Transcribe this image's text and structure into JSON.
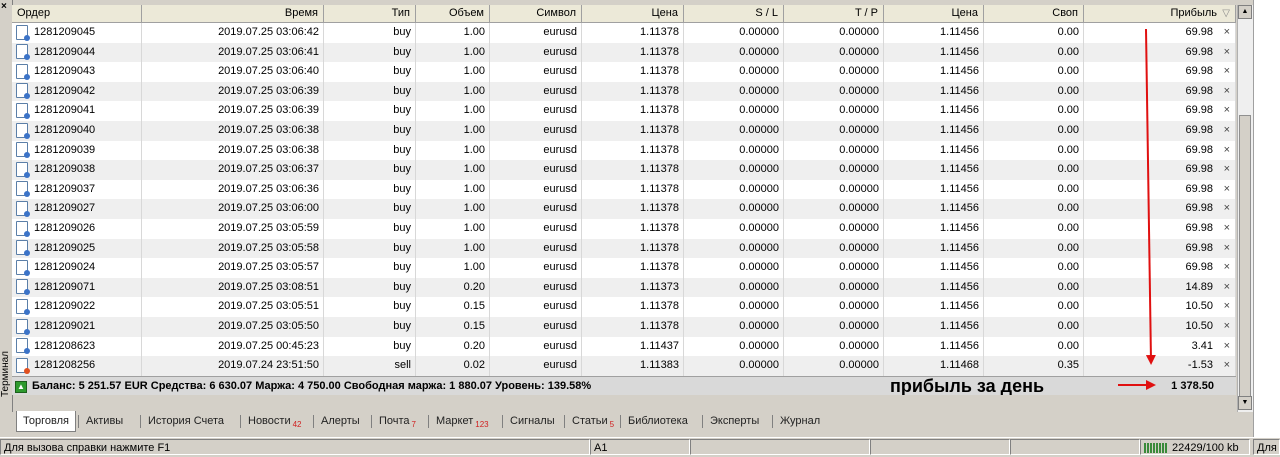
{
  "terminal_label": "Терминал",
  "close_symbol": "×",
  "columns": [
    {
      "label": "Ордер",
      "align": "left",
      "w": 130
    },
    {
      "label": "Время",
      "align": "right",
      "w": 182
    },
    {
      "label": "Тип",
      "align": "right",
      "w": 92
    },
    {
      "label": "Объем",
      "align": "right",
      "w": 74
    },
    {
      "label": "Символ",
      "align": "right",
      "w": 92
    },
    {
      "label": "Цена",
      "align": "right",
      "w": 102
    },
    {
      "label": "S / L",
      "align": "right",
      "w": 100
    },
    {
      "label": "T / P",
      "align": "right",
      "w": 100
    },
    {
      "label": "Цена",
      "align": "right",
      "w": 100
    },
    {
      "label": "Своп",
      "align": "right",
      "w": 100
    },
    {
      "label": "Прибыль",
      "align": "right",
      "w": 152
    }
  ],
  "sort_indicator": "▽",
  "rows": [
    [
      "1281209045",
      "2019.07.25 03:06:42",
      "buy",
      "1.00",
      "eurusd",
      "1.11378",
      "0.00000",
      "0.00000",
      "1.11456",
      "0.00",
      "69.98"
    ],
    [
      "1281209044",
      "2019.07.25 03:06:41",
      "buy",
      "1.00",
      "eurusd",
      "1.11378",
      "0.00000",
      "0.00000",
      "1.11456",
      "0.00",
      "69.98"
    ],
    [
      "1281209043",
      "2019.07.25 03:06:40",
      "buy",
      "1.00",
      "eurusd",
      "1.11378",
      "0.00000",
      "0.00000",
      "1.11456",
      "0.00",
      "69.98"
    ],
    [
      "1281209042",
      "2019.07.25 03:06:39",
      "buy",
      "1.00",
      "eurusd",
      "1.11378",
      "0.00000",
      "0.00000",
      "1.11456",
      "0.00",
      "69.98"
    ],
    [
      "1281209041",
      "2019.07.25 03:06:39",
      "buy",
      "1.00",
      "eurusd",
      "1.11378",
      "0.00000",
      "0.00000",
      "1.11456",
      "0.00",
      "69.98"
    ],
    [
      "1281209040",
      "2019.07.25 03:06:38",
      "buy",
      "1.00",
      "eurusd",
      "1.11378",
      "0.00000",
      "0.00000",
      "1.11456",
      "0.00",
      "69.98"
    ],
    [
      "1281209039",
      "2019.07.25 03:06:38",
      "buy",
      "1.00",
      "eurusd",
      "1.11378",
      "0.00000",
      "0.00000",
      "1.11456",
      "0.00",
      "69.98"
    ],
    [
      "1281209038",
      "2019.07.25 03:06:37",
      "buy",
      "1.00",
      "eurusd",
      "1.11378",
      "0.00000",
      "0.00000",
      "1.11456",
      "0.00",
      "69.98"
    ],
    [
      "1281209037",
      "2019.07.25 03:06:36",
      "buy",
      "1.00",
      "eurusd",
      "1.11378",
      "0.00000",
      "0.00000",
      "1.11456",
      "0.00",
      "69.98"
    ],
    [
      "1281209027",
      "2019.07.25 03:06:00",
      "buy",
      "1.00",
      "eurusd",
      "1.11378",
      "0.00000",
      "0.00000",
      "1.11456",
      "0.00",
      "69.98"
    ],
    [
      "1281209026",
      "2019.07.25 03:05:59",
      "buy",
      "1.00",
      "eurusd",
      "1.11378",
      "0.00000",
      "0.00000",
      "1.11456",
      "0.00",
      "69.98"
    ],
    [
      "1281209025",
      "2019.07.25 03:05:58",
      "buy",
      "1.00",
      "eurusd",
      "1.11378",
      "0.00000",
      "0.00000",
      "1.11456",
      "0.00",
      "69.98"
    ],
    [
      "1281209024",
      "2019.07.25 03:05:57",
      "buy",
      "1.00",
      "eurusd",
      "1.11378",
      "0.00000",
      "0.00000",
      "1.11456",
      "0.00",
      "69.98"
    ],
    [
      "1281209071",
      "2019.07.25 03:08:51",
      "buy",
      "0.20",
      "eurusd",
      "1.11373",
      "0.00000",
      "0.00000",
      "1.11456",
      "0.00",
      "14.89"
    ],
    [
      "1281209022",
      "2019.07.25 03:05:51",
      "buy",
      "0.15",
      "eurusd",
      "1.11378",
      "0.00000",
      "0.00000",
      "1.11456",
      "0.00",
      "10.50"
    ],
    [
      "1281209021",
      "2019.07.25 03:05:50",
      "buy",
      "0.15",
      "eurusd",
      "1.11378",
      "0.00000",
      "0.00000",
      "1.11456",
      "0.00",
      "10.50"
    ],
    [
      "1281208623",
      "2019.07.25 00:45:23",
      "buy",
      "0.20",
      "eurusd",
      "1.11437",
      "0.00000",
      "0.00000",
      "1.11456",
      "0.00",
      "3.41"
    ],
    [
      "1281208256",
      "2019.07.24 23:51:50",
      "sell",
      "0.02",
      "eurusd",
      "1.11383",
      "0.00000",
      "0.00000",
      "1.11468",
      "0.35",
      "-1.53"
    ]
  ],
  "delete_symbol": "×",
  "balance_line": "Баланс: 5 251.57 EUR  Средства: 6 630.07  Маржа: 4 750.00  Свободная маржа: 1 880.07  Уровень: 139.58%",
  "annotation": "прибыль за день",
  "total_profit": "1 378.50",
  "accent_red": "#e01010",
  "tabs": [
    {
      "label": "Торговля",
      "badge": "",
      "active": true
    },
    {
      "label": "Активы",
      "badge": ""
    },
    {
      "label": "История Счета",
      "badge": ""
    },
    {
      "label": "Новости",
      "badge": "42"
    },
    {
      "label": "Алерты",
      "badge": ""
    },
    {
      "label": "Почта",
      "badge": "7"
    },
    {
      "label": "Маркет",
      "badge": "123"
    },
    {
      "label": "Сигналы",
      "badge": ""
    },
    {
      "label": "Статьи",
      "badge": "5"
    },
    {
      "label": "Библиотека",
      "badge": ""
    },
    {
      "label": "Эксперты",
      "badge": ""
    },
    {
      "label": "Журнал",
      "badge": ""
    }
  ],
  "status": {
    "help": "Для вызова справки нажмите F1",
    "cell": "A1",
    "traffic": "22429/100 kb",
    "right_cut": "Для"
  }
}
